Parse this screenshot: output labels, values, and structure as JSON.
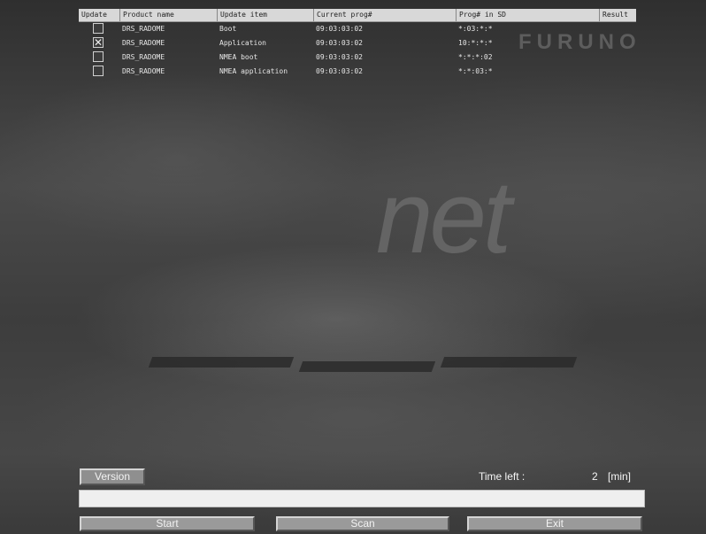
{
  "table": {
    "headers": [
      "Update",
      "Product name",
      "Update item",
      "Current prog#",
      "Prog# in SD",
      "Result"
    ],
    "rows": [
      {
        "checked": false,
        "product": "DRS_RADOME",
        "item": "Boot",
        "current": "09:03:03:02",
        "sd": "*:03:*:*",
        "result": ""
      },
      {
        "checked": true,
        "product": "DRS_RADOME",
        "item": "Application",
        "current": "09:03:03:02",
        "sd": "10:*:*:*",
        "result": ""
      },
      {
        "checked": false,
        "product": "DRS_RADOME",
        "item": "NMEA boot",
        "current": "09:03:03:02",
        "sd": "*:*:*:02",
        "result": ""
      },
      {
        "checked": false,
        "product": "DRS_RADOME",
        "item": "NMEA application",
        "current": "09:03:03:02",
        "sd": "*:*:03:*",
        "result": ""
      }
    ]
  },
  "check_mark": "✕",
  "background": {
    "logo": "FURUNO",
    "net_text": "net"
  },
  "controls": {
    "version_label": "Version",
    "time_left_label": "Time left :",
    "time_left_value": "2",
    "time_left_unit": "[min]",
    "progress_fraction": 0,
    "start_label": "Start",
    "scan_label": "Scan",
    "exit_label": "Exit"
  },
  "colors": {
    "header_bg": "#d8d8d8",
    "button_face": "#9a9a9a",
    "progress_bg": "#efefef"
  }
}
